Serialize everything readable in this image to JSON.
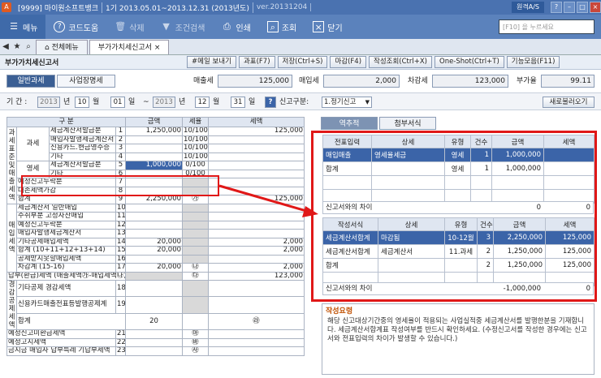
{
  "window": {
    "logo_text": "A",
    "segments": [
      "[9999] 마이원소프트뱅크",
      "1기 2013.05.01~2013.12.31 (2013년도)",
      "ver.20131204"
    ],
    "help_label": "원격A/S"
  },
  "toolbar": {
    "items": [
      {
        "label": "메뉴",
        "icon": "menu-icon"
      },
      {
        "label": "코드도움",
        "icon": "help-icon"
      },
      {
        "label": "삭제",
        "icon": "trash-icon"
      },
      {
        "label": "조건검색",
        "icon": "filter-icon"
      },
      {
        "label": "인쇄",
        "icon": "printer-icon"
      },
      {
        "label": "조회",
        "icon": "search-icon"
      },
      {
        "label": "닫기",
        "icon": "close-icon"
      }
    ],
    "search_placeholder": "[F10] 을 누르세요"
  },
  "tabs": {
    "items": [
      "전체메뉴",
      "부가가치세신고서"
    ]
  },
  "form": {
    "title": "부가가치세신고서",
    "buttons": [
      "#메일 보내기",
      "과표(F7)",
      "저장(Ctrl+S)",
      "마감(F4)",
      "작성조회(Ctrl+X)",
      "One-Shot(Ctrl+T)",
      "기능모음(F11)"
    ]
  },
  "subtabs": [
    "일반과세",
    "사업장명세"
  ],
  "summary": {
    "sales_tax_label": "매출세",
    "sales_tax": "125,000",
    "purchase_tax_label": "매입세",
    "purchase_tax": "2,000",
    "diff_tax_label": "차감세",
    "diff_tax": "123,000",
    "rate_label": "부가율",
    "rate": "99.11"
  },
  "period": {
    "label": "기 간 :",
    "from_year": "2013",
    "year_unit": "년",
    "from_month": "10",
    "month_unit": "월",
    "from_day": "01",
    "day_unit": "일",
    "tilde": "~",
    "to_year": "2013",
    "to_month": "12",
    "to_day": "31",
    "report_label": "신고구분:",
    "report_value": "1.정기신고",
    "refresh_btn": "새로불러오기"
  },
  "grid": {
    "headers": [
      "구 분",
      "",
      "금액",
      "세율",
      "세액"
    ],
    "vert_sales": "과세표준및매출세액",
    "vert_purchase": "매입세액",
    "vert_reduce": "경감공제세액",
    "rows": [
      {
        "g2": "과세",
        "label": "세금계산서발급분",
        "no": "1",
        "amount": "1,250,000",
        "rate": "10/100",
        "tax": "125,000"
      },
      {
        "g2": "",
        "label": "매입자발행세금계산서",
        "no": "2",
        "amount": "",
        "rate": "10/100",
        "tax": ""
      },
      {
        "g2": "",
        "label": "신용카드.현금영수증",
        "no": "3",
        "amount": "",
        "rate": "10/100",
        "tax": ""
      },
      {
        "g2": "",
        "label": "기타",
        "no": "4",
        "amount": "",
        "rate": "10/100",
        "tax": ""
      },
      {
        "g2": "영세",
        "label": "세금계산서발급분",
        "no": "5",
        "amount": "1,000,000",
        "rate": "0/100",
        "tax": ""
      },
      {
        "g2": "",
        "label": "기타",
        "no": "6",
        "amount": "",
        "rate": "0/100",
        "tax": ""
      },
      {
        "g2": "",
        "label": "예정신고누락분",
        "no": "7",
        "amount": "",
        "rate": "",
        "tax": ""
      },
      {
        "g2": "",
        "label": "대손세액가감",
        "no": "8",
        "amount": "",
        "rate": "",
        "tax": ""
      },
      {
        "g2": "",
        "label": "합계",
        "no": "9",
        "amount": "2,250,000",
        "rate": "㉮",
        "tax": "125,000"
      },
      {
        "g2": "",
        "label": "세금계산서 일반매입",
        "no": "10",
        "amount": "",
        "rate": "",
        "tax": ""
      },
      {
        "g2": "",
        "label": "수취부분 고정자산매입",
        "no": "11",
        "amount": "",
        "rate": "",
        "tax": ""
      },
      {
        "g2": "",
        "label": "예정신고누락분",
        "no": "12",
        "amount": "",
        "rate": "",
        "tax": ""
      },
      {
        "g2": "",
        "label": "매입자발행세금계산서",
        "no": "13",
        "amount": "",
        "rate": "",
        "tax": ""
      },
      {
        "g2": "",
        "label": "기타공제매입세액",
        "no": "14",
        "amount": "20,000",
        "rate": "",
        "tax": "2,000"
      },
      {
        "g2": "",
        "label": "합계 (10+11+12+13+14)",
        "no": "15",
        "amount": "20,000",
        "rate": "",
        "tax": "2,000"
      },
      {
        "g2": "",
        "label": "공제받지못할매입세액",
        "no": "16",
        "amount": "",
        "rate": "",
        "tax": ""
      },
      {
        "g2": "",
        "label": "차감계 (15-16)",
        "no": "17",
        "amount": "20,000",
        "rate": "㉯",
        "tax": "2,000"
      },
      {
        "g2": "",
        "label": "납부(환급)세액 (매출세액㉮-매입세액㉯)",
        "no": "",
        "amount": "",
        "rate": "㉰",
        "tax": "123,000"
      },
      {
        "g2": "",
        "label": "기타공제 경감세액",
        "no": "18",
        "amount": "",
        "rate": "",
        "tax": ""
      },
      {
        "g2": "",
        "label": "신용카드매출전표등발행공제계",
        "no": "19",
        "amount": "",
        "rate": "",
        "tax": ""
      },
      {
        "g2": "",
        "label": "합계",
        "no": "20",
        "amount": "",
        "rate": "㉱",
        "tax": ""
      },
      {
        "g2": "",
        "label": "예정신고미환급세액",
        "no": "21",
        "amount": "",
        "rate": "㉲",
        "tax": ""
      },
      {
        "g2": "",
        "label": "예정고지세액",
        "no": "22",
        "amount": "",
        "rate": "㉳",
        "tax": ""
      },
      {
        "g2": "",
        "label": "금지금 매입자 납부특례 기납부세액",
        "no": "23",
        "amount": "",
        "rate": "㉴",
        "tax": ""
      }
    ]
  },
  "right_tabs": [
    "역추적",
    "첨부서식"
  ],
  "top_table": {
    "headers": [
      "전표입력",
      "상세",
      "유형",
      "건수",
      "금액",
      "세액"
    ],
    "rows": [
      {
        "c1": "매입매출",
        "c2": "영세율세금",
        "c3": "영세",
        "c4": "1",
        "c5": "1,000,000",
        "c6": ""
      },
      {
        "c1": "합계",
        "c2": "",
        "c3": "영세",
        "c4": "1",
        "c5": "1,000,000",
        "c6": ""
      },
      {
        "c1": "",
        "c2": "",
        "c3": "",
        "c4": "",
        "c5": "",
        "c6": ""
      },
      {
        "c1": "",
        "c2": "",
        "c3": "",
        "c4": "",
        "c5": "",
        "c6": ""
      }
    ],
    "footer_label": "신고서와의 차이",
    "footer_amount": "0",
    "footer_tax": "0"
  },
  "bottom_table": {
    "headers": [
      "작성서식",
      "상세",
      "유형",
      "건수",
      "금액",
      "세액"
    ],
    "rows": [
      {
        "c1": "세금계산서합계",
        "c2": "마감됨",
        "c3": "10-12월",
        "c4": "3",
        "c5": "2,250,000",
        "c6": "125,000"
      },
      {
        "c1": "세금계산서합계",
        "c2": "세금계산서",
        "c3": "11.과세",
        "c4": "2",
        "c5": "1,250,000",
        "c6": "125,000"
      },
      {
        "c1": "합계",
        "c2": "",
        "c3": "",
        "c4": "2",
        "c5": "1,250,000",
        "c6": "125,000"
      },
      {
        "c1": "",
        "c2": "",
        "c3": "",
        "c4": "",
        "c5": "",
        "c6": ""
      }
    ],
    "footer_label": "신고서와의 차이",
    "footer_amount": "-1,000,000",
    "footer_tax": "0"
  },
  "memo": {
    "title": "작성요령",
    "body": "해당 신고대상기간중의 영세율이 적용되는 사업실적중 세금계산서를 발행한분을 기재합니다. 세금계산서합계표 작성여부를 반드시 확인하세요. (수정신고서를 작성한 경우에는 신고서와 전표입력의 차이가 발생할 수 있습니다.)"
  },
  "colors": {
    "accent": "#5b82bc",
    "highlight": "#e01818",
    "selected": "#3b64a8"
  }
}
